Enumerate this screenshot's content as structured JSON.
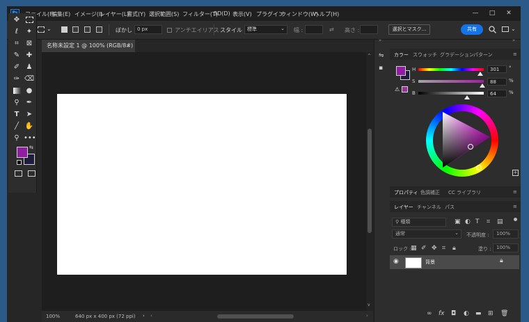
{
  "app": {
    "logo": "Ps",
    "menu": [
      "ファイル(F)",
      "編集(E)",
      "イメージ(I)",
      "レイヤー(L)",
      "書式(Y)",
      "選択範囲(S)",
      "フィルター(T)",
      "3D(D)",
      "表示(V)",
      "プラグイン",
      "ウィンドウ(W)",
      "ヘルプ(H)"
    ],
    "window_controls": [
      "—",
      "□",
      "✕"
    ]
  },
  "options": {
    "blur_label": "ぼかし :",
    "blur_value": "0 px",
    "antialias_label": "アンチエイリアス",
    "style_label": "スタイル :",
    "style_value": "標準",
    "width_label": "幅 :",
    "height_label": "高さ :",
    "select_mask_button": "選択とマスク...",
    "share_button": "共有"
  },
  "document": {
    "tab_title": "名称未設定 1 @ 100% (RGB/8#)",
    "zoom": "100%",
    "size_info": "640 px x 400 px (72 ppi)"
  },
  "colors": {
    "foreground": "#8f1fa0",
    "background": "#1e1e3c",
    "accent": "#1473e6",
    "canvas": "#ffffff"
  },
  "color_panel": {
    "tabs": [
      "カラー",
      "スウォッチ",
      "グラデーション",
      "パターン"
    ],
    "h_label": "H",
    "h_value": "301",
    "h_unit": "°",
    "s_label": "S",
    "s_value": "88",
    "s_unit": "%",
    "b_label": "B",
    "b_value": "64",
    "b_unit": "%"
  },
  "properties_panel": {
    "tabs": [
      "プロパティ",
      "色調補正",
      "CC ライブラリ"
    ]
  },
  "layers_panel": {
    "tabs": [
      "レイヤー",
      "チャンネル",
      "パス"
    ],
    "filter_placeholder": "種類",
    "blend_mode": "通常",
    "opacity_label": "不透明度 :",
    "opacity_value": "100%",
    "lock_label": "ロック :",
    "fill_label": "塗り :",
    "fill_value": "100%",
    "layers": [
      {
        "name": "背景",
        "visible": true,
        "locked": true
      }
    ],
    "footer_icons": [
      "link-icon",
      "fx-icon",
      "mask-icon",
      "adjustment-icon",
      "folder-icon",
      "new-layer-icon",
      "trash-icon"
    ]
  }
}
